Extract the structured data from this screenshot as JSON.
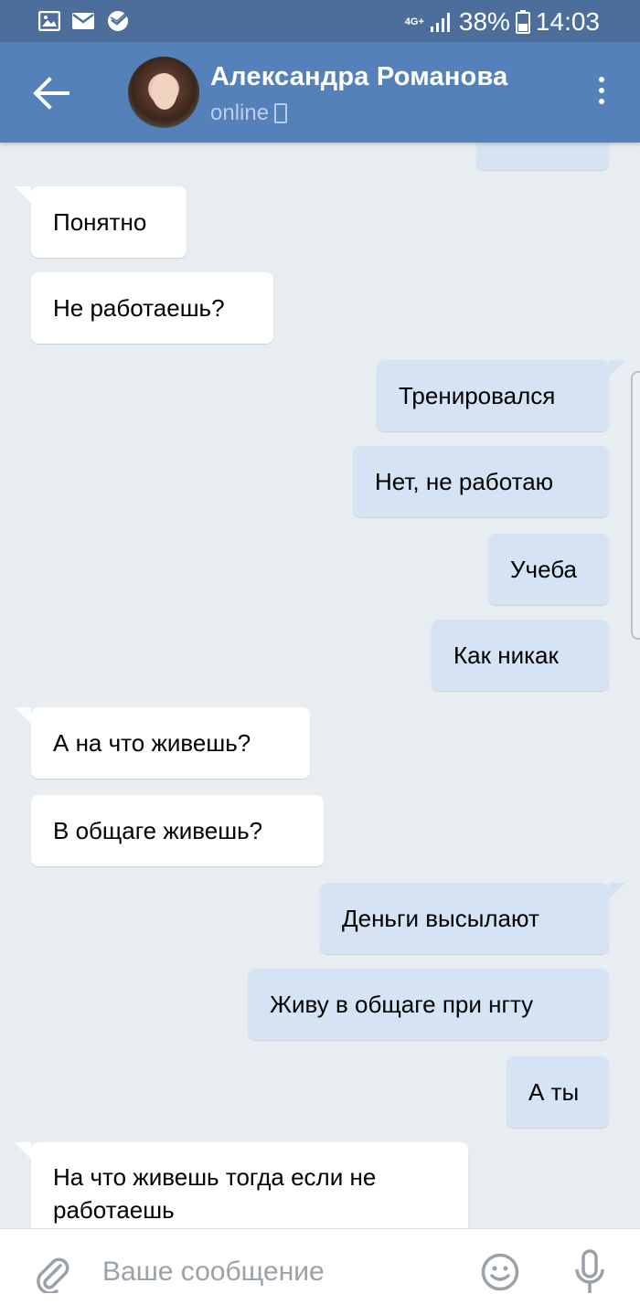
{
  "status_bar": {
    "network": "4G+",
    "battery": "38%",
    "time": "14:03",
    "icons": [
      "image-icon",
      "mail-icon",
      "sberbank-icon",
      "signal-icon",
      "battery-icon"
    ]
  },
  "header": {
    "contact_name": "Александра Романова",
    "status": "online"
  },
  "messages": [
    {
      "from": "them",
      "text": "Понятно"
    },
    {
      "from": "them",
      "text": "Не работаешь?"
    },
    {
      "from": "me",
      "text": "Тренировался"
    },
    {
      "from": "me",
      "text": "Нет, не работаю"
    },
    {
      "from": "me",
      "text": "Учеба"
    },
    {
      "from": "me",
      "text": "Как никак"
    },
    {
      "from": "them",
      "text": "А на что живешь?"
    },
    {
      "from": "them",
      "text": "В общаге живешь?"
    },
    {
      "from": "me",
      "text": "Деньги высылают"
    },
    {
      "from": "me",
      "text": "Живу в общаге при нгту"
    },
    {
      "from": "me",
      "text": "А ты"
    },
    {
      "from": "them",
      "text": "На что живешь тогда если не работаешь"
    }
  ],
  "input": {
    "placeholder": "Ваше сообщение"
  },
  "colors": {
    "status_bar": "#4d6e9a",
    "header": "#5581bb",
    "chat_background": "#e8edf2",
    "incoming_bubble": "#ffffff",
    "outgoing_bubble": "#d5e3f5"
  }
}
